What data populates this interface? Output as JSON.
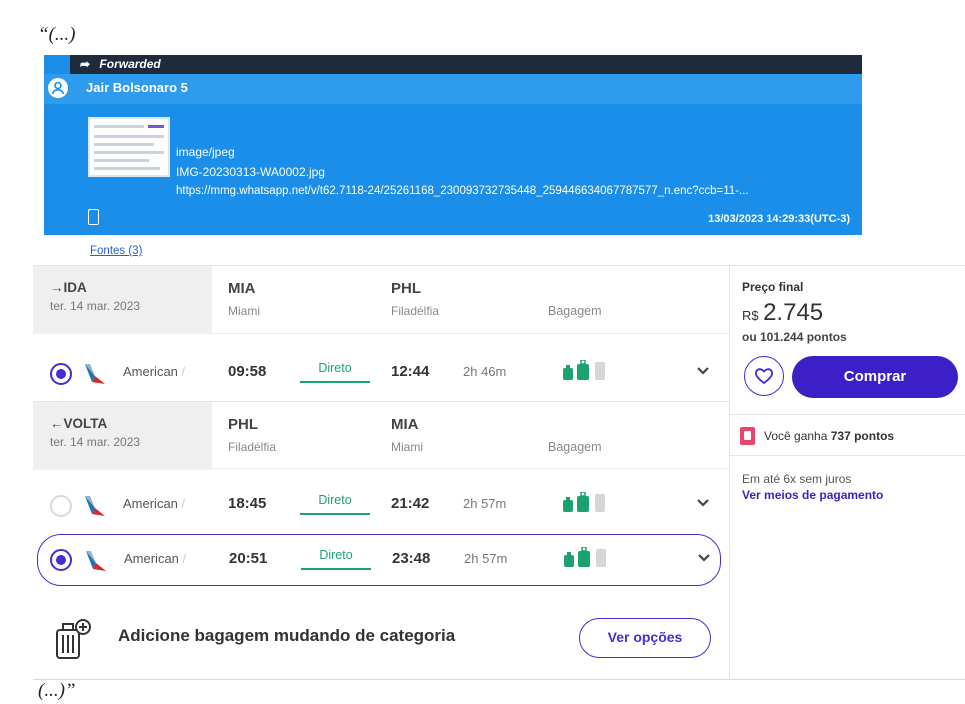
{
  "quote": {
    "open": "“(...)",
    "close": "(...)”"
  },
  "whatsapp": {
    "forwarded_label": "Forwarded",
    "sender": "Jair Bolsonaro 5",
    "mime": "image/jpeg",
    "filename": "IMG-20230313-WA0002.jpg",
    "url": "https://mmg.whatsapp.net/v/t62.7118-24/25261168_230093732735448_259446634067787577_n.enc?ccb=11-...",
    "timestamp": "13/03/2023 14:29:33(UTC-3)"
  },
  "sources_link": "Fontes (3)",
  "outbound": {
    "tag": "IDA",
    "date": "ter. 14 mar. 2023",
    "from_code": "MIA",
    "from_city": "Miami",
    "to_code": "PHL",
    "to_city": "Filadélfia",
    "baggage_label": "Bagagem",
    "flights": [
      {
        "airline": "American",
        "dep": "09:58",
        "stops": "Direto",
        "arr": "12:44",
        "duration": "2h 46m",
        "selected": true
      }
    ]
  },
  "return": {
    "tag": "VOLTA",
    "date": "ter. 14 mar. 2023",
    "from_code": "PHL",
    "from_city": "Filadélfia",
    "to_code": "MIA",
    "to_city": "Miami",
    "baggage_label": "Bagagem",
    "flights": [
      {
        "airline": "American",
        "dep": "18:45",
        "stops": "Direto",
        "arr": "21:42",
        "duration": "2h 57m",
        "selected": false
      },
      {
        "airline": "American",
        "dep": "20:51",
        "stops": "Direto",
        "arr": "23:48",
        "duration": "2h 57m",
        "selected": true
      }
    ]
  },
  "add_baggage": {
    "text": "Adicione bagagem mudando de categoria",
    "button": "Ver opções"
  },
  "price": {
    "label": "Preço final",
    "currency": "R$",
    "value": "2.745",
    "points": "ou 101.244 pontos",
    "buy_button": "Comprar",
    "earn_prefix": "Você ganha",
    "earn_points": "737 pontos",
    "installments": "Em até 6x sem juros",
    "payment_link": "Ver meios de pagamento"
  },
  "colors": {
    "brand": "#3d1fc7",
    "whatsapp_blue": "#1a8ee8",
    "direct_green": "#1aa36f"
  }
}
